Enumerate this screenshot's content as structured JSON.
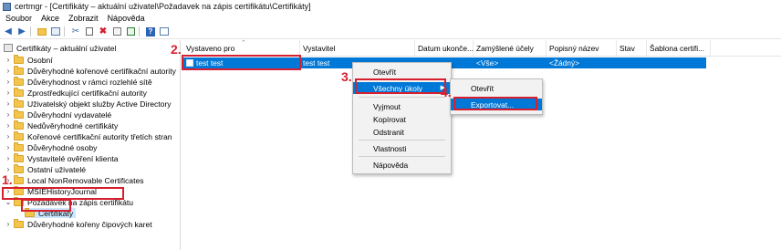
{
  "window": {
    "title": "certmgr - [Certifikáty – aktuální uživatel\\Požadavek na zápis certifikátu\\Certifikáty]"
  },
  "menu": [
    "Soubor",
    "Akce",
    "Zobrazit",
    "Nápověda"
  ],
  "tree": {
    "root": "Certifikáty – aktuální uživatel",
    "items": [
      "Osobní",
      "Důvěryhodné kořenové certifikační autority",
      "Důvěryhodnost v rámci rozlehlé sítě",
      "Zprostředkující certifikační autority",
      "Uživatelský objekt služby Active Directory",
      "Důvěryhodní vydavatelé",
      "Nedůvěryhodné certifikáty",
      "Kořenové certifikační autority třetích stran",
      "Důvěryhodné osoby",
      "Vystavitelé ověření klienta",
      "Ostatní uživatelé",
      "Local NonRemovable Certificates",
      "MSIEHistoryJournal",
      "Požadavek na zápis certifikátu",
      "Certifikáty",
      "Důvěryhodné kořeny čipových karet"
    ]
  },
  "list": {
    "columns": [
      "Vystaveno pro",
      "Vystavitel",
      "Datum ukonče...",
      "Zamýšlené účely",
      "Popisný název",
      "Stav",
      "Šablona certifi..."
    ],
    "row": {
      "issued_to": "test test",
      "issuer": "test test",
      "purposes": "<Vše>",
      "friendly_name": "<Žádný>"
    }
  },
  "context_menu": {
    "items": [
      "Otevřít",
      "Všechny úkoly",
      "Vyjmout",
      "Kopírovat",
      "Odstranit",
      "Vlastnosti",
      "Nápověda"
    ]
  },
  "submenu": {
    "items": [
      "Otevřít",
      "Exportovat..."
    ]
  },
  "steps": [
    "1.",
    "2.",
    "3.",
    "4."
  ],
  "colors": {
    "selection": "#0078d7",
    "annotation_red": "#d6202f",
    "folder": "#f3c54d"
  }
}
